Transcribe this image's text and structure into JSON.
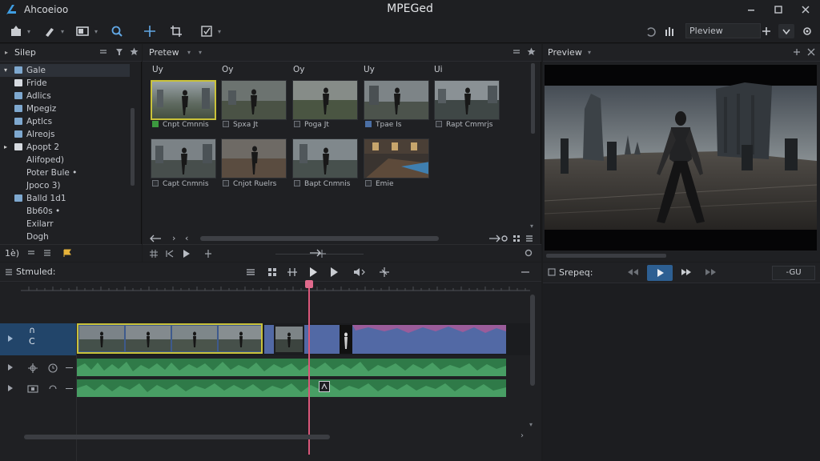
{
  "app": {
    "name": "Ahcoeioo",
    "title": "MPEGed"
  },
  "toolbar": {
    "preview_select": "Pleview"
  },
  "left_panel": {
    "title": "Silep",
    "items": [
      {
        "label": "Gale",
        "selected": true
      },
      {
        "label": "Fride"
      },
      {
        "label": "Adlics"
      },
      {
        "label": "Mpegiz"
      },
      {
        "label": "Aptlcs"
      },
      {
        "label": "Alreojs"
      },
      {
        "label": "Apopt 2"
      },
      {
        "label": "Alifoped)"
      },
      {
        "label": "Poter Bule •"
      },
      {
        "label": "Jpoco 3)"
      },
      {
        "label": "Balld 1d1"
      },
      {
        "label": "Bb60s •"
      },
      {
        "label": "Exilarr"
      },
      {
        "label": "Dogh"
      }
    ],
    "footer_value": "1è)"
  },
  "media_panel": {
    "title": "Pretew",
    "columns": [
      "Uy",
      "Oy",
      "Oy",
      "Uy",
      "Ui"
    ],
    "clips": [
      {
        "caption": "Cnpt Cmnnis",
        "mark": "#3c9a3f"
      },
      {
        "caption": "Spxa Jt",
        "mark": "#2c2e32"
      },
      {
        "caption": "Poga Jt",
        "mark": "#2c2e32"
      },
      {
        "caption": "Tpae Is",
        "mark": "#4b6fa5"
      },
      {
        "caption": "Rapt Cmmrjs",
        "mark": "#2c2e32"
      },
      {
        "caption": "Capt Cnmnis",
        "mark": "#2c2e32"
      },
      {
        "caption": "Cnjot Ruelrs",
        "mark": "#2c2e32"
      },
      {
        "caption": "Bapt Cnmnis",
        "mark": "#2c2e32"
      },
      {
        "caption": "Emie",
        "mark": "#2c2e32"
      }
    ]
  },
  "preview_panel": {
    "title": "Preview"
  },
  "timeline": {
    "title": "Stmuled:",
    "video_track_label": "C"
  },
  "transport": {
    "label": "Srepeq:",
    "timecode": "-GU"
  }
}
